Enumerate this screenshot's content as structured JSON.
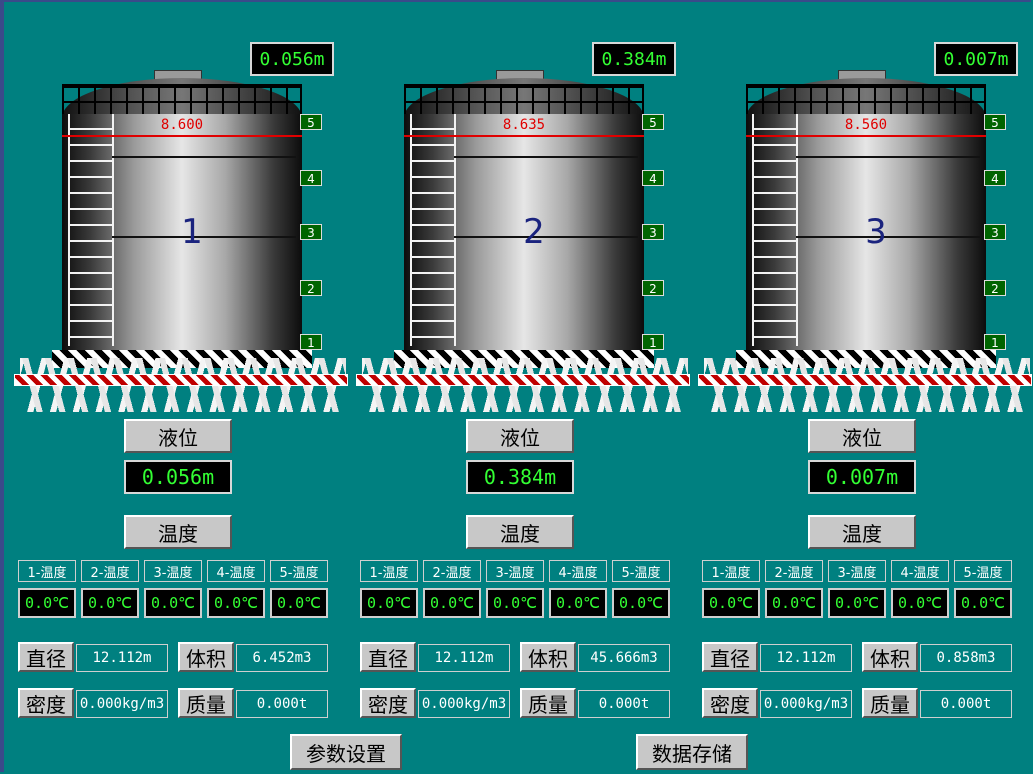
{
  "tanks": [
    {
      "top_level": "0.056m",
      "red_value": "8.600",
      "number": "1",
      "marks": [
        "5",
        "4",
        "3",
        "2",
        "1"
      ],
      "level_label": "液位",
      "level_value": "0.056m",
      "temp_label": "温度",
      "temp_labels": [
        "1-温度",
        "2-温度",
        "3-温度",
        "4-温度",
        "5-温度"
      ],
      "temp_values": [
        "0.0℃",
        "0.0℃",
        "0.0℃",
        "0.0℃",
        "0.0℃"
      ],
      "diameter_label": "直径",
      "diameter_value": "12.112m",
      "volume_label": "体积",
      "volume_value": "6.452m3",
      "density_label": "密度",
      "density_value": "0.000kg/m3",
      "mass_label": "质量",
      "mass_value": "0.000t"
    },
    {
      "top_level": "0.384m",
      "red_value": "8.635",
      "number": "2",
      "marks": [
        "5",
        "4",
        "3",
        "2",
        "1"
      ],
      "level_label": "液位",
      "level_value": "0.384m",
      "temp_label": "温度",
      "temp_labels": [
        "1-温度",
        "2-温度",
        "3-温度",
        "4-温度",
        "5-温度"
      ],
      "temp_values": [
        "0.0℃",
        "0.0℃",
        "0.0℃",
        "0.0℃",
        "0.0℃"
      ],
      "diameter_label": "直径",
      "diameter_value": "12.112m",
      "volume_label": "体积",
      "volume_value": "45.666m3",
      "density_label": "密度",
      "density_value": "0.000kg/m3",
      "mass_label": "质量",
      "mass_value": "0.000t"
    },
    {
      "top_level": "0.007m",
      "red_value": "8.560",
      "number": "3",
      "marks": [
        "5",
        "4",
        "3",
        "2",
        "1"
      ],
      "level_label": "液位",
      "level_value": "0.007m",
      "temp_label": "温度",
      "temp_labels": [
        "1-温度",
        "2-温度",
        "3-温度",
        "4-温度",
        "5-温度"
      ],
      "temp_values": [
        "0.0℃",
        "0.0℃",
        "0.0℃",
        "0.0℃",
        "0.0℃"
      ],
      "diameter_label": "直径",
      "diameter_value": "12.112m",
      "volume_label": "体积",
      "volume_value": "0.858m3",
      "density_label": "密度",
      "density_value": "0.000kg/m3",
      "mass_label": "质量",
      "mass_value": "0.000t"
    }
  ],
  "actions": {
    "settings_label": "参数设置",
    "save_label": "数据存储"
  },
  "colors": {
    "background": "#008080",
    "display_text": "#33ff33",
    "red_line": "#e00000"
  }
}
